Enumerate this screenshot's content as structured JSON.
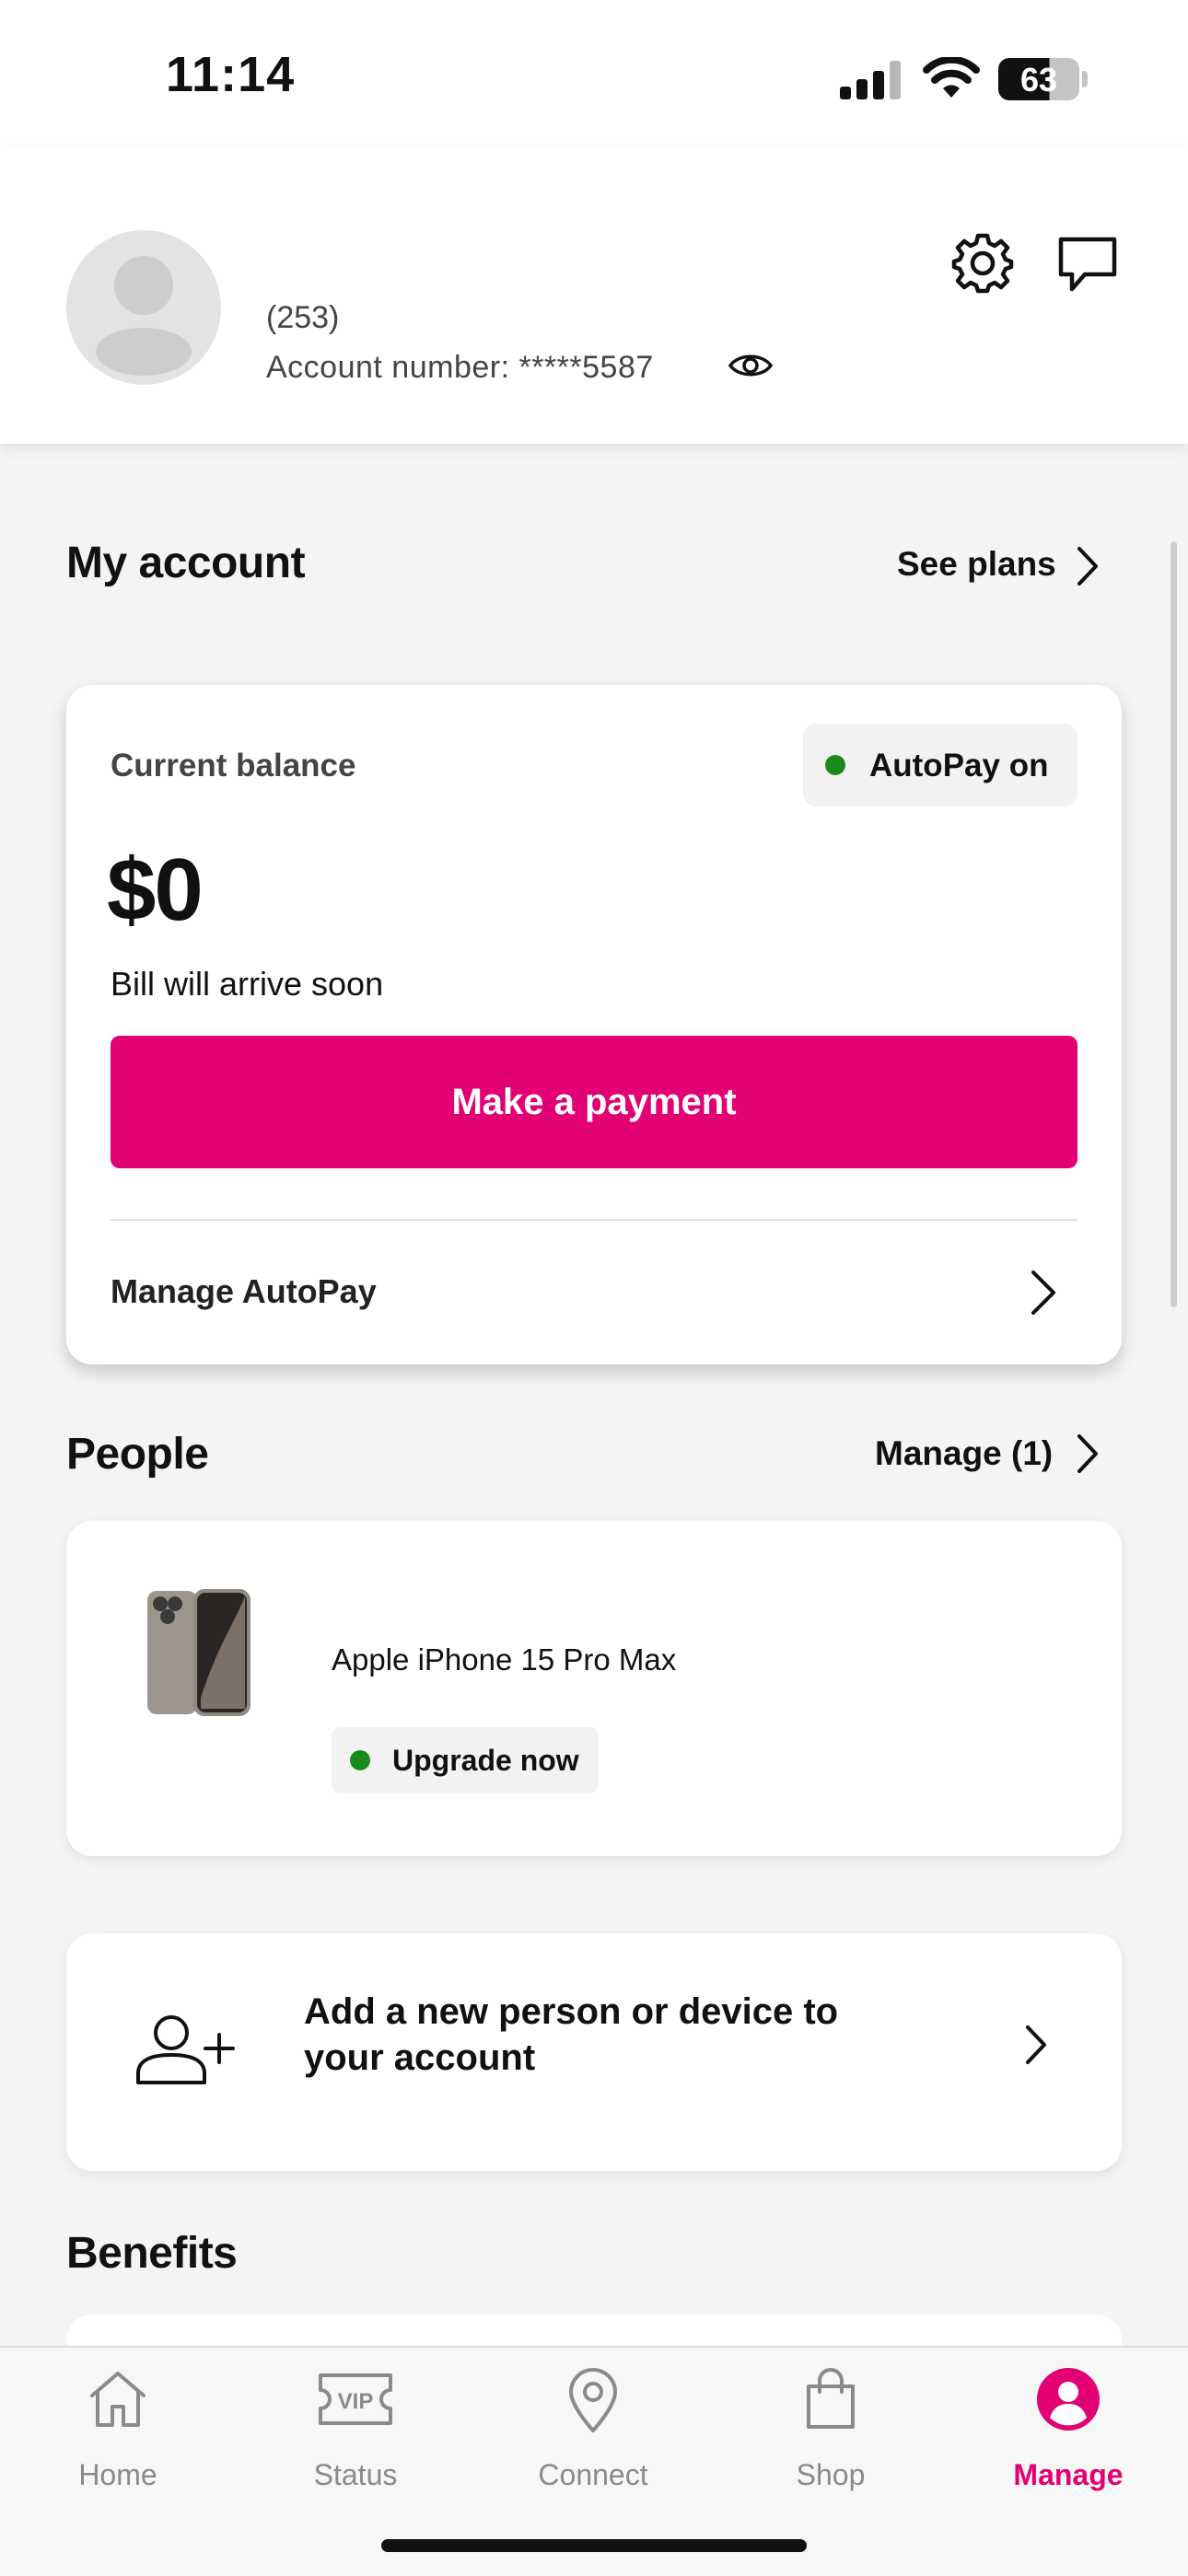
{
  "status_bar": {
    "time": "11:14",
    "battery": "63"
  },
  "profile": {
    "phone": "(253)",
    "account_number": "Account number: *****5587"
  },
  "my_account": {
    "title": "My account",
    "see_plans": "See plans",
    "balance_label": "Current balance",
    "autopay_badge": "AutoPay on",
    "amount": "$0",
    "bill_note": "Bill will arrive soon",
    "pay_button": "Make a payment",
    "manage_autopay": "Manage AutoPay"
  },
  "people": {
    "title": "People",
    "manage_link": "Manage (1)",
    "device_name": "Apple iPhone 15 Pro Max",
    "upgrade_badge": "Upgrade now"
  },
  "add_person": {
    "label_line1": "Add a new person or device to",
    "label_line2": "your account"
  },
  "benefits": {
    "title": "Benefits"
  },
  "tabs": [
    {
      "label": "Home",
      "icon": "home-icon"
    },
    {
      "label": "Status",
      "icon": "vip-icon"
    },
    {
      "label": "Connect",
      "icon": "location-pin-icon"
    },
    {
      "label": "Shop",
      "icon": "shopping-bag-icon"
    },
    {
      "label": "Manage",
      "icon": "profile-icon",
      "active": true
    }
  ],
  "colors": {
    "brand_magenta": "#e20074",
    "status_green": "#1a8a1a",
    "inactive_tab": "#8a8a8a"
  }
}
